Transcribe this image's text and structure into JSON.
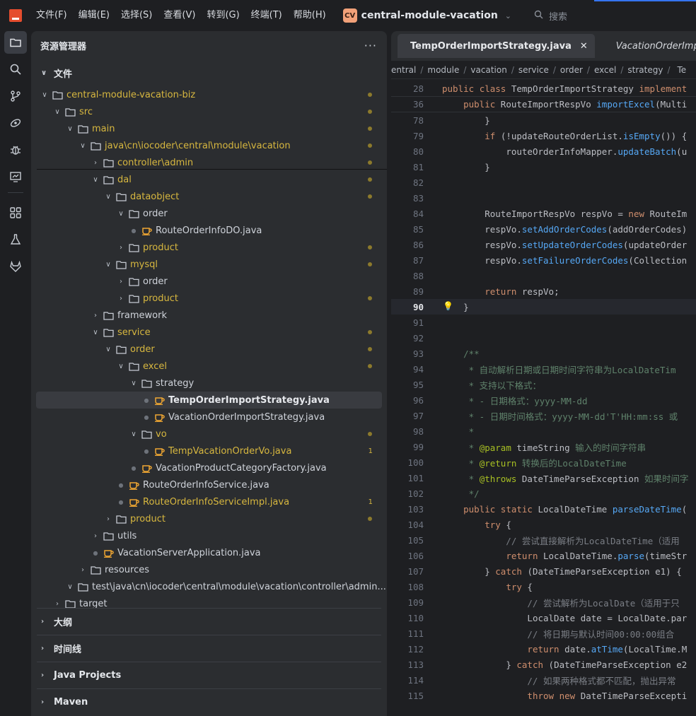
{
  "titlebar": {
    "menus": [
      "文件(F)",
      "编辑(E)",
      "选择(S)",
      "查看(V)",
      "转到(G)",
      "终端(T)",
      "帮助(H)"
    ],
    "project_badge": "CV",
    "project_name": "central-module-vacation",
    "search_placeholder": "搜索"
  },
  "sidebar": {
    "title": "资源管理器",
    "more": "···",
    "files_section": "文件",
    "tree": [
      {
        "label": "central-module-vacation-biz",
        "depth": 0,
        "kind": "folder",
        "open": true,
        "color": "yellow",
        "mark": "dot"
      },
      {
        "label": "src",
        "depth": 1,
        "kind": "folder",
        "open": true,
        "color": "yellow",
        "mark": "dot"
      },
      {
        "label": "main",
        "depth": 2,
        "kind": "folder",
        "open": true,
        "color": "yellow",
        "mark": "dot"
      },
      {
        "label": "java\\cn\\iocoder\\central\\module\\vacation",
        "depth": 3,
        "kind": "folder",
        "open": true,
        "color": "yellow",
        "mark": "dot"
      },
      {
        "label": "controller\\admin",
        "depth": 4,
        "kind": "folder",
        "open": false,
        "color": "yellow",
        "mark": "dot"
      },
      {
        "label": "dal",
        "depth": 4,
        "kind": "folder",
        "open": true,
        "color": "yellow",
        "mark": "dot"
      },
      {
        "label": "dataobject",
        "depth": 5,
        "kind": "folder",
        "open": true,
        "color": "yellow",
        "mark": "dot"
      },
      {
        "label": "order",
        "depth": 6,
        "kind": "folder",
        "open": true,
        "color": "normal",
        "mark": ""
      },
      {
        "label": "RouteOrderInfoDO.java",
        "depth": 7,
        "kind": "java",
        "color": "normal",
        "mark": ""
      },
      {
        "label": "product",
        "depth": 6,
        "kind": "folder",
        "open": false,
        "color": "yellow",
        "mark": "dot"
      },
      {
        "label": "mysql",
        "depth": 5,
        "kind": "folder",
        "open": true,
        "color": "yellow",
        "mark": "dot"
      },
      {
        "label": "order",
        "depth": 6,
        "kind": "folder",
        "open": false,
        "color": "normal",
        "mark": ""
      },
      {
        "label": "product",
        "depth": 6,
        "kind": "folder",
        "open": false,
        "color": "yellow",
        "mark": "dot"
      },
      {
        "label": "framework",
        "depth": 4,
        "kind": "folder",
        "open": false,
        "color": "normal",
        "mark": ""
      },
      {
        "label": "service",
        "depth": 4,
        "kind": "folder",
        "open": true,
        "color": "yellow",
        "mark": "dot"
      },
      {
        "label": "order",
        "depth": 5,
        "kind": "folder",
        "open": true,
        "color": "yellow",
        "mark": "dot"
      },
      {
        "label": "excel",
        "depth": 6,
        "kind": "folder",
        "open": true,
        "color": "yellow",
        "mark": "dot"
      },
      {
        "label": "strategy",
        "depth": 7,
        "kind": "folder",
        "open": true,
        "color": "normal",
        "mark": ""
      },
      {
        "label": "TempOrderImportStrategy.java",
        "depth": 8,
        "kind": "java",
        "color": "bright",
        "mark": "",
        "selected": true
      },
      {
        "label": "VacationOrderImportStrategy.java",
        "depth": 8,
        "kind": "java",
        "color": "normal",
        "mark": ""
      },
      {
        "label": "vo",
        "depth": 7,
        "kind": "folder",
        "open": true,
        "color": "yellow",
        "mark": "dot"
      },
      {
        "label": "TempVacationOrderVo.java",
        "depth": 8,
        "kind": "java",
        "color": "yellow",
        "mark": "count",
        "count": "1"
      },
      {
        "label": "VacationProductCategoryFactory.java",
        "depth": 7,
        "kind": "java",
        "color": "normal",
        "mark": ""
      },
      {
        "label": "RouteOrderInfoService.java",
        "depth": 6,
        "kind": "java",
        "color": "normal",
        "mark": ""
      },
      {
        "label": "RouteOrderInfoServiceImpl.java",
        "depth": 6,
        "kind": "java",
        "color": "yellow",
        "mark": "count",
        "count": "1"
      },
      {
        "label": "product",
        "depth": 5,
        "kind": "folder",
        "open": false,
        "color": "yellow",
        "mark": "dot"
      },
      {
        "label": "utils",
        "depth": 4,
        "kind": "folder",
        "open": false,
        "color": "normal",
        "mark": ""
      },
      {
        "label": "VacationServerApplication.java",
        "depth": 4,
        "kind": "java",
        "color": "normal",
        "mark": ""
      },
      {
        "label": "resources",
        "depth": 3,
        "kind": "folder",
        "open": false,
        "color": "normal",
        "mark": ""
      },
      {
        "label": "test\\java\\cn\\iocoder\\central\\module\\vacation\\controller\\admin...",
        "depth": 2,
        "kind": "folder",
        "open": true,
        "color": "normal",
        "mark": ""
      },
      {
        "label": "target",
        "depth": 1,
        "kind": "folder",
        "open": false,
        "color": "normal",
        "mark": ""
      }
    ],
    "sections": [
      "大纲",
      "时间线",
      "Java Projects",
      "Maven"
    ]
  },
  "editor": {
    "tabs": [
      {
        "label": "TempOrderImportStrategy.java",
        "active": true,
        "close": "✕"
      },
      {
        "label": "VacationOrderImportStra",
        "active": false
      }
    ],
    "breadcrumb": [
      "entral",
      "module",
      "vacation",
      "service",
      "order",
      "excel",
      "strategy",
      "Te"
    ],
    "sticky_lines": [
      {
        "num": "28",
        "code": "public class TempOrderImportStrategy implement"
      },
      {
        "num": "36",
        "code": "    public RouteImportRespVo importExcel(Multi"
      }
    ],
    "lines": [
      {
        "num": "78",
        "code": "        }"
      },
      {
        "num": "79",
        "code": "        if (!updateRouteOrderList.isEmpty()) {"
      },
      {
        "num": "80",
        "code": "            routeOrderInfoMapper.updateBatch(u"
      },
      {
        "num": "81",
        "code": "        }"
      },
      {
        "num": "82",
        "code": ""
      },
      {
        "num": "83",
        "code": ""
      },
      {
        "num": "84",
        "code": "        RouteImportRespVo respVo = new RouteIm"
      },
      {
        "num": "85",
        "code": "        respVo.setAddOrderCodes(addOrderCodes)"
      },
      {
        "num": "86",
        "code": "        respVo.setUpdateOrderCodes(updateOrder"
      },
      {
        "num": "87",
        "code": "        respVo.setFailureOrderCodes(Collection"
      },
      {
        "num": "88",
        "code": ""
      },
      {
        "num": "89",
        "code": "        return respVo;"
      },
      {
        "num": "90",
        "code": "    }"
      },
      {
        "num": "91",
        "code": ""
      },
      {
        "num": "92",
        "code": ""
      },
      {
        "num": "93",
        "code": "    /**"
      },
      {
        "num": "94",
        "code": "     * 自动解析日期或日期时间字符串为LocalDateTim"
      },
      {
        "num": "95",
        "code": "     * 支持以下格式："
      },
      {
        "num": "96",
        "code": "     * - 日期格式：yyyy-MM-dd"
      },
      {
        "num": "97",
        "code": "     * - 日期时间格式：yyyy-MM-dd'T'HH:mm:ss 或"
      },
      {
        "num": "98",
        "code": "     *"
      },
      {
        "num": "99",
        "code": "     * @param timeString 输入的时间字符串"
      },
      {
        "num": "100",
        "code": "     * @return 转换后的LocalDateTime"
      },
      {
        "num": "101",
        "code": "     * @throws DateTimeParseException 如果时间字"
      },
      {
        "num": "102",
        "code": "     */"
      },
      {
        "num": "103",
        "code": "    public static LocalDateTime parseDateTime("
      },
      {
        "num": "104",
        "code": "        try {"
      },
      {
        "num": "105",
        "code": "            // 尝试直接解析为LocalDateTime（适用"
      },
      {
        "num": "106",
        "code": "            return LocalDateTime.parse(timeStr"
      },
      {
        "num": "107",
        "code": "        } catch (DateTimeParseException e1) {"
      },
      {
        "num": "108",
        "code": "            try {"
      },
      {
        "num": "109",
        "code": "                // 尝试解析为LocalDate（适用于只"
      },
      {
        "num": "110",
        "code": "                LocalDate date = LocalDate.par"
      },
      {
        "num": "111",
        "code": "                // 将日期与默认时间00:00:00组合"
      },
      {
        "num": "112",
        "code": "                return date.atTime(LocalTime.M"
      },
      {
        "num": "113",
        "code": "            } catch (DateTimeParseException e2"
      },
      {
        "num": "114",
        "code": "                // 如果两种格式都不匹配，抛出异常"
      },
      {
        "num": "115",
        "code": "                throw new DateTimeParseExcepti"
      }
    ],
    "current_line": "90"
  },
  "colors": {
    "accent": "#3574f0",
    "folder_modified": "#d7b73f",
    "java_icon": "#f0a732",
    "keyword": "#cf8e6d",
    "method": "#56a8f5"
  }
}
